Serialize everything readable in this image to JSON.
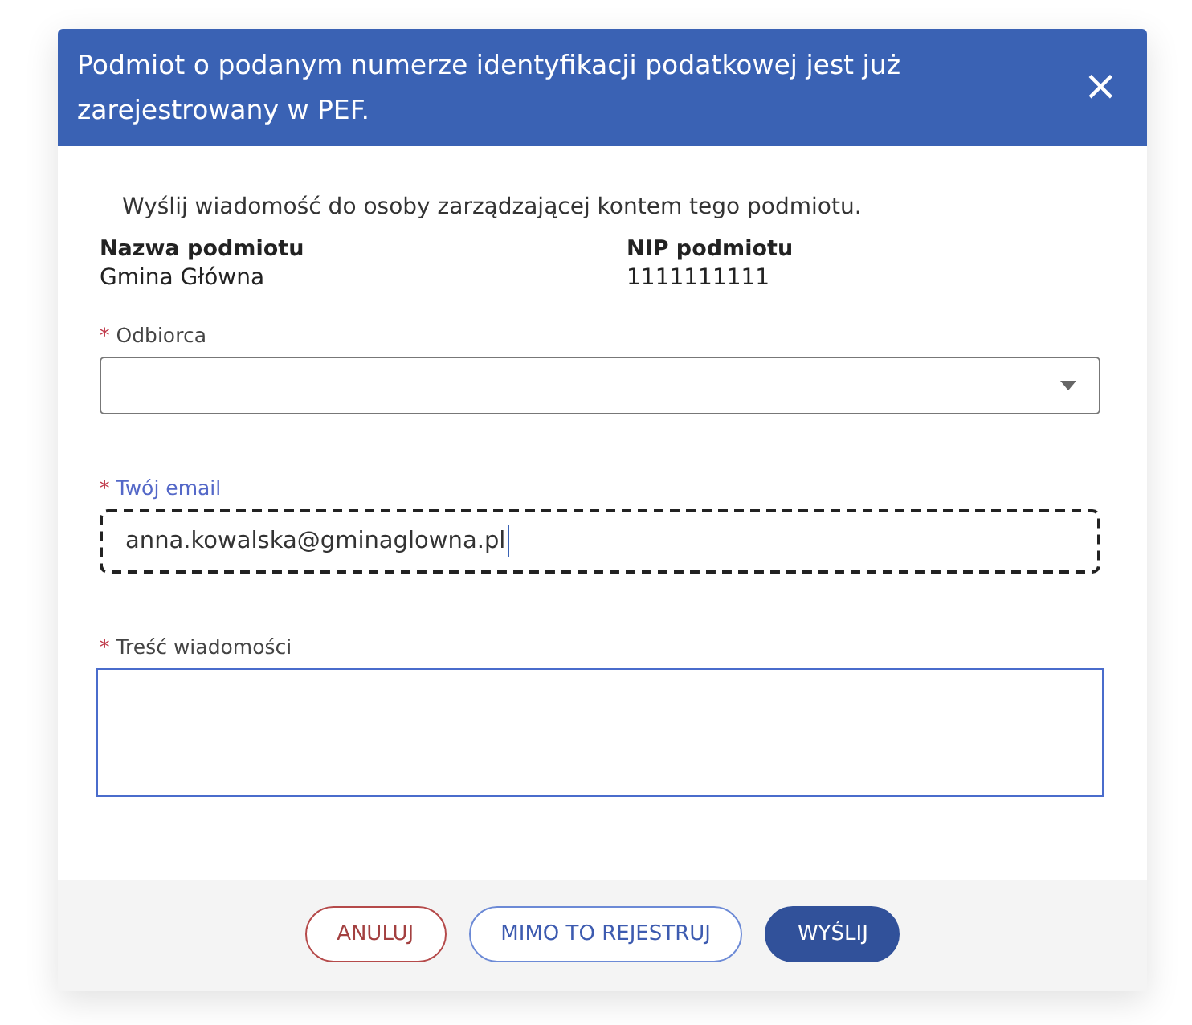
{
  "dialog": {
    "title": "Podmiot o podanym numerze identyfikacji podatkowej jest już zarejestrowany w PEF.",
    "close": "×"
  },
  "intro": "Wyślij wiadomość do osoby zarządzającej kontem tego podmiotu.",
  "info": [
    {
      "label": "Nazwa podmiotu",
      "value": "Gmina Główna"
    },
    {
      "label": "NIP podmiotu",
      "value": "1111111111"
    }
  ],
  "fields": [
    {
      "kind": "select",
      "label": "Odbiorca",
      "required": "*",
      "focused": false
    },
    {
      "kind": "text",
      "label": "Twój email",
      "required": "*",
      "value": "anna.kowalska@gminaglowna.pl",
      "focused": true
    },
    {
      "kind": "textarea",
      "label": "Treść wiadomości",
      "required": "*",
      "focused": false
    }
  ],
  "buttons": [
    {
      "kind": "cancel",
      "label": "ANULUJ"
    },
    {
      "kind": "secondary",
      "label": "MIMO TO REJESTRUJ"
    },
    {
      "kind": "primary",
      "label": "WYŚLIJ"
    }
  ]
}
